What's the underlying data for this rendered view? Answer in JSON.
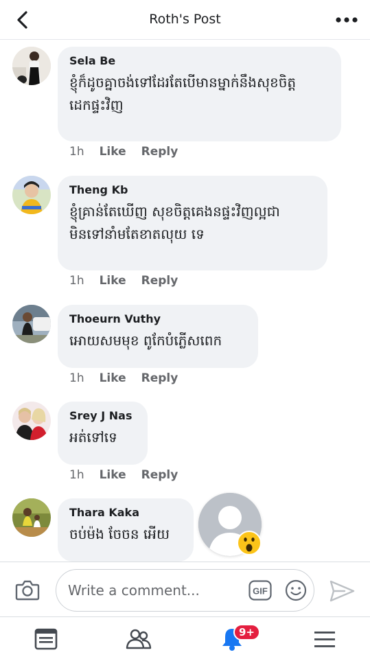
{
  "header": {
    "title": "Roth's Post"
  },
  "comments": [
    {
      "author": "Sela Be",
      "lines": [
        "ខ្ញុំក៏ដូចគ្នាចង់ទៅដែរតែបើមានម្នាក់នឹងសុខចិត្ត",
        "ដេកផ្ទះវិញ"
      ],
      "time": "1h",
      "like_label": "Like",
      "reply_label": "Reply"
    },
    {
      "author": "Theng Kb",
      "lines": [
        "ខ្ញុំគ្រាន់តែឃើញ  សុខចិត្តគេងនផ្ទះវិញល្អជា",
        "មិនទៅនាំមតែខាតលុយ ទេ"
      ],
      "time": "1h",
      "like_label": "Like",
      "reply_label": "Reply"
    },
    {
      "author": "Thoeurn Vuthy",
      "lines": [
        "អោយសមមុខ ពូកែបំភ្លើសពេក"
      ],
      "time": "1h",
      "like_label": "Like",
      "reply_label": "Reply"
    },
    {
      "author": "Srey J Nas",
      "lines": [
        "អត់ទៅទេ"
      ],
      "time": "1h",
      "like_label": "Like",
      "reply_label": "Reply"
    },
    {
      "author": "Thara Kaka",
      "lines": [
        "ចប់ម៉ង ចែចន អើយ"
      ]
    }
  ],
  "composer": {
    "placeholder": "Write a comment...",
    "gif_label": "GIF"
  },
  "notifications": {
    "badge": "9+"
  },
  "colors": {
    "bubble": "#f0f2f5",
    "accent": "#1877f2",
    "badge": "#e41e3f",
    "muted": "#65676b"
  },
  "icons": {
    "back": "chevron-left-icon",
    "more": "more-dots-icon",
    "camera": "camera-icon",
    "gif": "gif-icon",
    "emoji": "emoji-icon",
    "send": "send-icon",
    "feed": "news-feed-icon",
    "friends": "friends-icon",
    "notifications": "bell-icon",
    "menu": "menu-icon",
    "reaction": "wow-reaction-icon"
  }
}
